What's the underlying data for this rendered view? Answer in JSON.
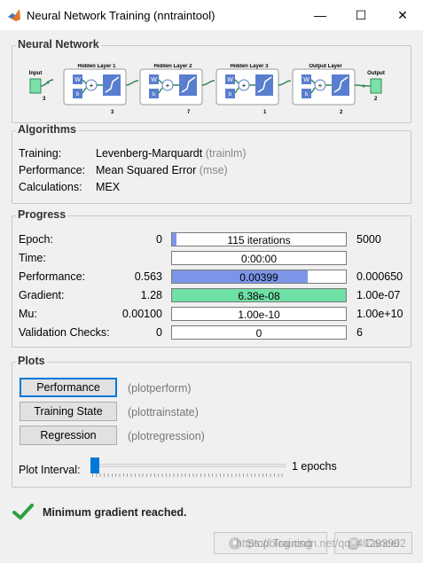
{
  "window": {
    "title": "Neural Network Training (nntraintool)",
    "minimize_glyph": "—",
    "maximize_glyph": "☐",
    "close_glyph": "✕",
    "icon": "matlab-icon"
  },
  "network": {
    "section_title": "Neural Network",
    "input": {
      "label": "Input",
      "size": "3"
    },
    "layers": [
      {
        "label": "Hidden Layer 1",
        "size": "3",
        "transfer": "sigmoid"
      },
      {
        "label": "Hidden Layer 2",
        "size": "7",
        "transfer": "sigmoid"
      },
      {
        "label": "Hidden Layer 3",
        "size": "1",
        "transfer": "sigmoid"
      },
      {
        "label": "Output Layer",
        "size": "2",
        "transfer": "sigmoid"
      }
    ],
    "output": {
      "label": "Output",
      "size": "2"
    },
    "weight_label": "W",
    "bias_label": "b",
    "sum_glyph": "+"
  },
  "algorithms": {
    "section_title": "Algorithms",
    "rows": [
      {
        "label": "Training:",
        "value": "Levenberg-Marquardt",
        "fn": "(trainlm)"
      },
      {
        "label": "Performance:",
        "value": "Mean Squared Error",
        "fn": "(mse)"
      },
      {
        "label": "Calculations:",
        "value": "MEX",
        "fn": ""
      }
    ]
  },
  "progress": {
    "section_title": "Progress",
    "rows": [
      {
        "label": "Epoch:",
        "start": "0",
        "text": "115 iterations",
        "end": "5000",
        "fill": 0.023,
        "color": "#7b96e8"
      },
      {
        "label": "Time:",
        "start": "",
        "text": "0:00:00",
        "end": "",
        "fill": 0,
        "color": "#7b96e8"
      },
      {
        "label": "Performance:",
        "start": "0.563",
        "text": "0.00399",
        "end": "0.000650",
        "fill": 0.78,
        "color": "#7b96e8"
      },
      {
        "label": "Gradient:",
        "start": "1.28",
        "text": "6.38e-08",
        "end": "1.00e-07",
        "fill": 1.0,
        "color": "#6fe0a6"
      },
      {
        "label": "Mu:",
        "start": "0.00100",
        "text": "1.00e-10",
        "end": "1.00e+10",
        "fill": 0,
        "color": "#7b96e8"
      },
      {
        "label": "Validation Checks:",
        "start": "0",
        "text": "0",
        "end": "6",
        "fill": 0,
        "color": "#7b96e8"
      }
    ]
  },
  "plots": {
    "section_title": "Plots",
    "buttons": [
      {
        "label": "Performance",
        "fn": "(plotperform)"
      },
      {
        "label": "Training State",
        "fn": "(plottrainstate)"
      },
      {
        "label": "Regression",
        "fn": "(plotregression)"
      }
    ],
    "interval_label": "Plot Interval:",
    "interval_value": "1 epochs",
    "interval_fraction": 0.0
  },
  "status": {
    "message": "Minimum gradient reached.",
    "icon": "checkmark-icon"
  },
  "footer": {
    "stop_label": "Stop Training",
    "cancel_label": "Cancel",
    "watermark": "https://blog.csdn.net/qq_40293902"
  },
  "colors": {
    "accent": "#0078d7",
    "epoch_fill": "#7b96e8",
    "gradient_fill": "#6fe0a6",
    "diagram_weight": "#5a7ecf",
    "diagram_link": "#2e8b57",
    "status_check": "#2e9e3f"
  }
}
